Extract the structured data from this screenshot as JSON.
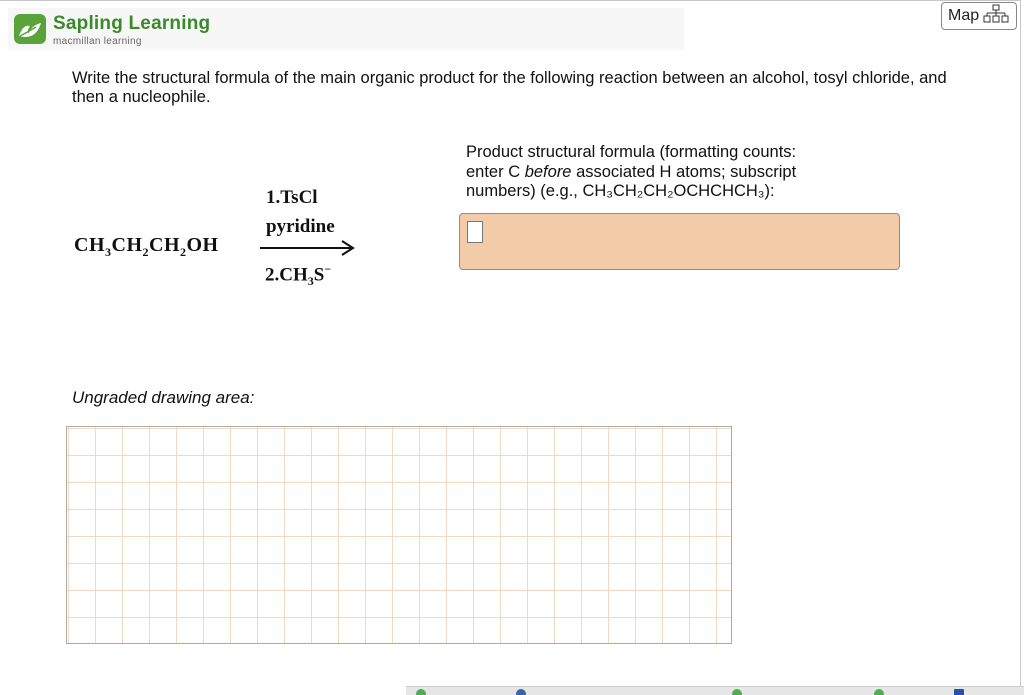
{
  "brand": {
    "name": "Sapling Learning",
    "tagline": "macmillan learning",
    "color": "#5aa33a"
  },
  "map_button": {
    "label": "Map",
    "icon": "sitemap-icon"
  },
  "question": "Write the structural formula of the main organic product for the following reaction between an alcohol, tosyl chloride, and then a nucleophile.",
  "reaction": {
    "reactant": [
      "CH",
      "3",
      "CH",
      "2",
      "CH",
      "2",
      "OH"
    ],
    "step1": "1.TsCl",
    "step1b": "pyridine",
    "step2_prefix": "2.CH",
    "step2_sub": "3",
    "step2_suffix": "S",
    "step2_charge": "−"
  },
  "prompt": {
    "line1": "Product structural formula (formatting counts:",
    "line2_a": "enter C ",
    "line2_em": "before",
    "line2_b": " associated H atoms; subscript",
    "line3": "numbers) (e.g., CH₃CH₂CH₂OCHCHCH₃):"
  },
  "answer_input": {
    "value": "",
    "color": "#f2cba8"
  },
  "drawing_label": "Ungraded drawing area:"
}
